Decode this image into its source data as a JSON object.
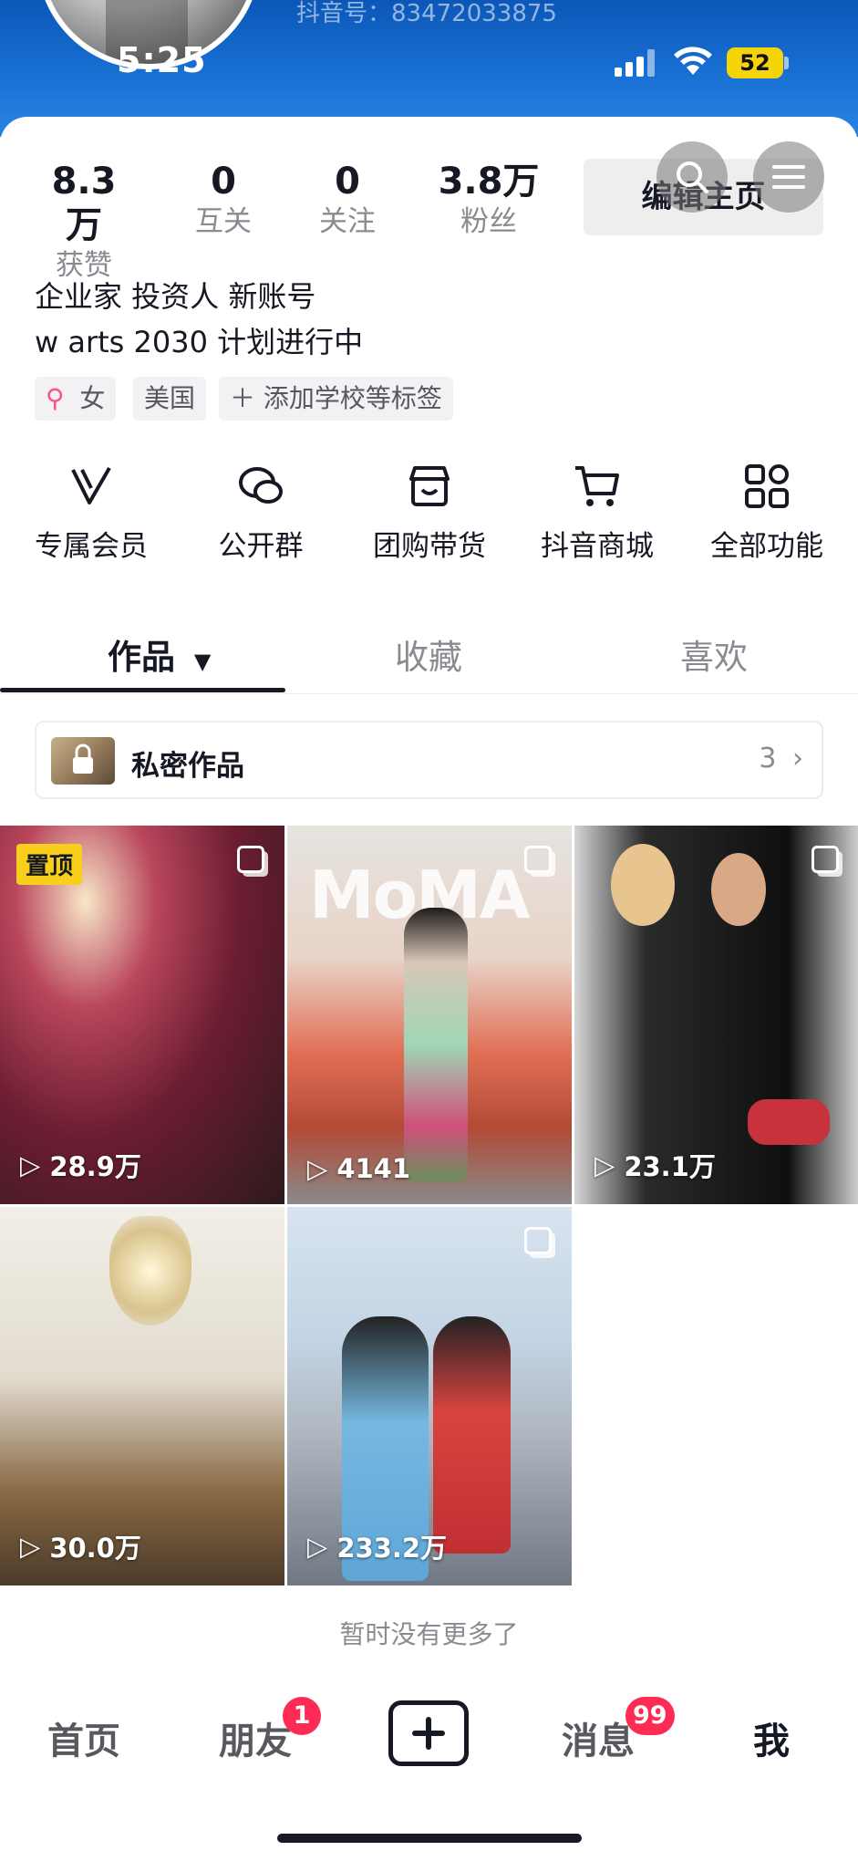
{
  "status_bar": {
    "time": "5:25",
    "battery": "52"
  },
  "profile": {
    "douyin_id": "抖音号：83472033875",
    "stats": [
      {
        "value": "8.3万",
        "label": "获赞"
      },
      {
        "value": "0",
        "label": "互关"
      },
      {
        "value": "0",
        "label": "关注"
      },
      {
        "value": "3.8万",
        "label": "粉丝"
      }
    ],
    "edit_button": "编辑主页",
    "bio_lines": [
      "企业家 投资人 新账号",
      "w arts 2030 计划进行中"
    ],
    "tags": {
      "gender": "女",
      "location": "美国",
      "add": "添加学校等标签"
    }
  },
  "features": [
    {
      "label": "专属会员",
      "icon": "vip-icon"
    },
    {
      "label": "公开群",
      "icon": "group-chat-icon"
    },
    {
      "label": "团购带货",
      "icon": "store-icon"
    },
    {
      "label": "抖音商城",
      "icon": "cart-icon"
    },
    {
      "label": "全部功能",
      "icon": "grid-icon"
    }
  ],
  "tabs": [
    {
      "label": "作品",
      "active": true
    },
    {
      "label": "收藏",
      "active": false
    },
    {
      "label": "喜欢",
      "active": false
    }
  ],
  "private_works": {
    "label": "私密作品",
    "count": "3"
  },
  "videos": [
    {
      "views": "28.9万",
      "pinned": "置顶"
    },
    {
      "views": "4141",
      "overlay_text": "MoMA"
    },
    {
      "views": "23.1万"
    },
    {
      "views": "30.0万"
    },
    {
      "views": "233.2万"
    }
  ],
  "no_more_text": "暂时没有更多了",
  "bottom_nav": {
    "home": "首页",
    "friends": "朋友",
    "friends_badge": "1",
    "messages": "消息",
    "messages_badge": "99",
    "me": "我"
  }
}
